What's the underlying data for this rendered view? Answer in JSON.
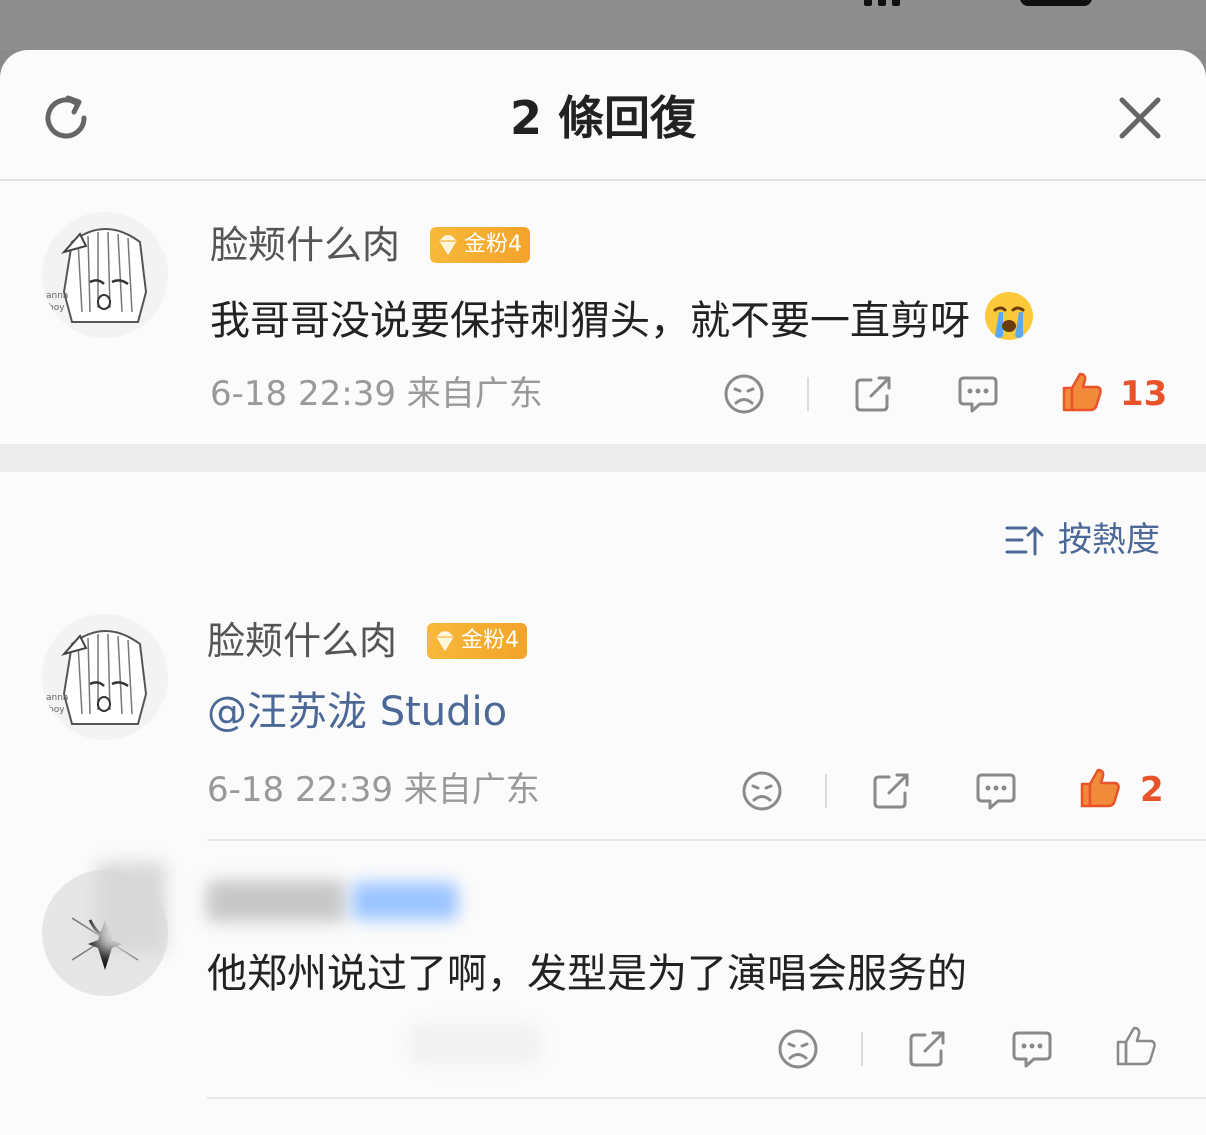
{
  "header": {
    "title": "2 條回復"
  },
  "root_comment": {
    "username": "脸颊什么肉",
    "badge": "金粉4",
    "text": "我哥哥没说要保持刺猬头，就不要一直剪呀",
    "emoji": "crying-face-icon",
    "time": "6-18 22:39",
    "location": "来自广东",
    "likes": "13"
  },
  "sort": {
    "label": "按熱度"
  },
  "replies": [
    {
      "username": "脸颊什么肉",
      "badge": "金粉4",
      "mention": "@汪苏泷 Studio",
      "time": "6-18 22:39",
      "location": "来自广东",
      "likes": "2"
    },
    {
      "text": "他郑州说过了啊，发型是为了演唱会服务的",
      "likes": ""
    }
  ],
  "colors": {
    "like_active": "#e8532a",
    "link": "#4c6896",
    "badge": "#f5ad32"
  }
}
